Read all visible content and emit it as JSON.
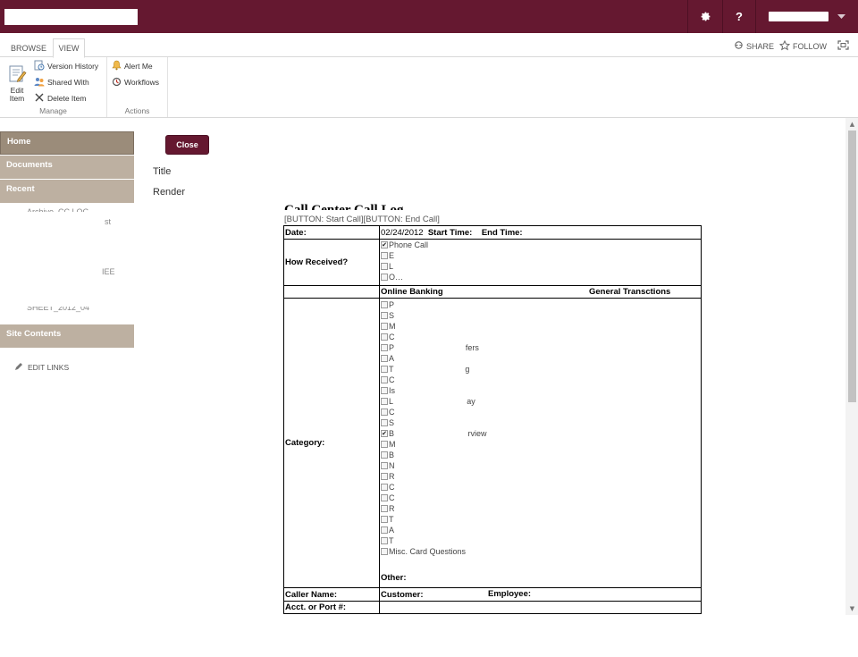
{
  "suitebar": {
    "icons": [
      "gear-icon",
      "help-icon",
      "chevron-down-icon"
    ]
  },
  "ribbon_tabs": {
    "browse": "BROWSE",
    "view": "VIEW"
  },
  "top_actions": {
    "share": "SHARE",
    "follow": "FOLLOW"
  },
  "ribbon": {
    "edit_item_line1": "Edit",
    "edit_item_line2": "Item",
    "version_history": "Version History",
    "shared_with": "Shared With",
    "delete_item": "Delete Item",
    "manage_label": "Manage",
    "alert_me": "Alert Me",
    "workflows": "Workflows",
    "actions_label": "Actions"
  },
  "nav": {
    "home": "Home",
    "documents": "Documents",
    "recent": "Recent",
    "recent_items": [
      "Archive_CC LOG",
      "st",
      "IEE",
      "SHEET_2012_04"
    ],
    "site_contents": "Site Contents",
    "edit_links": "EDIT LINKS"
  },
  "form": {
    "close": "Close",
    "title_label": "Title",
    "render_label": "Render"
  },
  "doc": {
    "title": "Call Center Call Log",
    "buttons": "[BUTTON: Start Call][BUTTON: End Call]",
    "date_label": "Date:",
    "date_value": "02/24/2012",
    "start_time": "Start Time:",
    "end_time": "End Time:",
    "how_received": "How Received?",
    "received_opts": [
      {
        "text": "Phone Call",
        "checked": true
      },
      {
        "text": "E",
        "checked": false
      },
      {
        "text": "L",
        "checked": false
      },
      {
        "text": "O…",
        "checked": false
      }
    ],
    "online_banking": "Online Banking",
    "general_transactions": "General Transctions",
    "category_label": "Category:",
    "category_opts": [
      {
        "text": "P",
        "checked": false
      },
      {
        "text": "S",
        "checked": false
      },
      {
        "text": "M",
        "checked": false
      },
      {
        "text": "C",
        "checked": false
      },
      {
        "text": "P                                fers",
        "checked": false
      },
      {
        "text": "A",
        "checked": false
      },
      {
        "text": "T                                g",
        "checked": false
      },
      {
        "text": "C",
        "checked": false
      },
      {
        "text": "Is",
        "checked": false
      },
      {
        "text": "L                                 ay",
        "checked": false
      },
      {
        "text": "C",
        "checked": false
      },
      {
        "text": "S",
        "checked": false
      },
      {
        "text": "B                                 rview",
        "checked": true
      },
      {
        "text": "M",
        "checked": false
      },
      {
        "text": "B",
        "checked": false
      },
      {
        "text": "N",
        "checked": false
      },
      {
        "text": "R",
        "checked": false
      },
      {
        "text": "C",
        "checked": false
      },
      {
        "text": "C",
        "checked": false
      },
      {
        "text": "R",
        "checked": false
      },
      {
        "text": "T",
        "checked": false
      },
      {
        "text": "A",
        "checked": false
      },
      {
        "text": "T",
        "checked": false
      },
      {
        "text": "Misc. Card Questions",
        "checked": false
      }
    ],
    "other_label": "Other:",
    "caller_name": "Caller Name:",
    "customer": "Customer:",
    "employee": "Employee:",
    "acct_label": "Acct. or Port #:"
  }
}
